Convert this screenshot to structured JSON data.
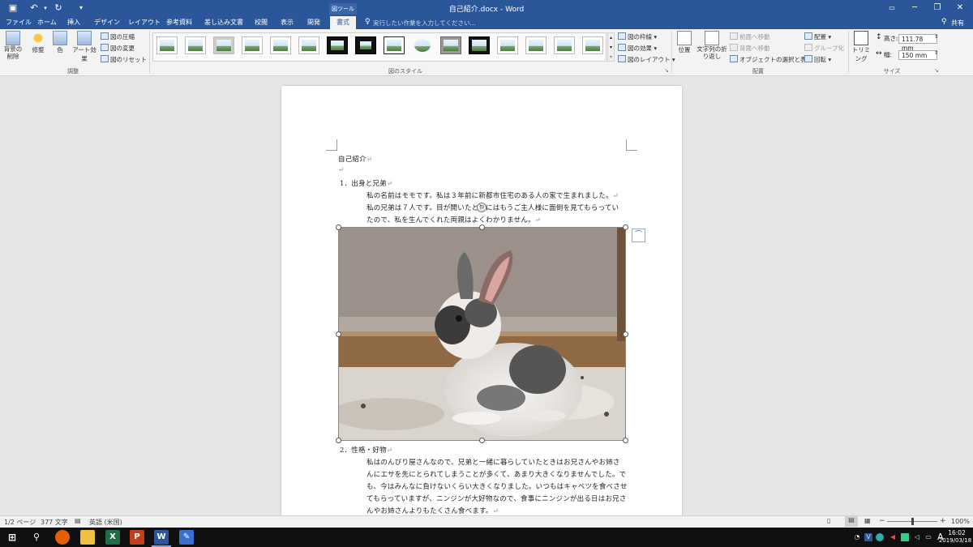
{
  "title_bar": {
    "title": "自己紹介.docx - Word",
    "context_label": "図ツール",
    "qat": {
      "save_icon": "save-icon",
      "undo_icon": "undo-icon",
      "redo_icon": "redo-icon",
      "customize_icon": "customize-qat-icon"
    },
    "window_controls": {
      "ribbon_display": "ribbon-display-icon",
      "minimize": "─",
      "restore": "❐",
      "close": "✕"
    }
  },
  "tabs": {
    "items": [
      "ファイル",
      "ホーム",
      "挿入",
      "デザイン",
      "レイアウト",
      "参考資料",
      "差し込み文書",
      "校閲",
      "表示",
      "開発",
      "書式"
    ],
    "active": "書式",
    "tell_me": "実行したい作業を入力してください...",
    "share": "共有"
  },
  "ribbon": {
    "adjust": {
      "remove_background": "背景の削除",
      "corrections": "修整",
      "color": "色",
      "artistic_effects": "アート効果",
      "compress": "図の圧縮",
      "change_picture": "図の変更",
      "reset_picture": "図のリセット",
      "group_label": "調整"
    },
    "styles": {
      "thumbs": [
        "simple-frame-white",
        "soft-edge",
        "simple-frame-gray",
        "drop-shadow",
        "reflected",
        "soft-rounded",
        "thick-black-frame",
        "heavy-black-frame",
        "simple-frame-black",
        "oval",
        "metal-frame",
        "black-rect",
        "beveled",
        "rotated-white",
        "perspective",
        "relaxed-perspective"
      ],
      "border": "図の枠線",
      "effects": "図の効果",
      "layout": "図のレイアウト",
      "group_label": "図のスタイル"
    },
    "arrange": {
      "position": "位置",
      "wrap_text": "文字列の折り返し",
      "bring_forward": "前面へ移動",
      "send_backward": "背面へ移動",
      "selection_pane": "オブジェクトの選択と表示",
      "align": "配置",
      "group": "グループ化",
      "rotate": "回転",
      "group_label": "配置"
    },
    "size": {
      "crop": "トリミング",
      "height_label": "高さ:",
      "height_value": "111.78 mm",
      "width_label": "幅:",
      "width_value": "150 mm",
      "group_label": "サイズ"
    }
  },
  "document": {
    "title": "自己紹介",
    "paragraph_mark": "↵",
    "section1_heading": "1．出身と兄弟",
    "section1_lines": [
      "私の名前はモモです。私は３年前に新都市住宅のある人の家で生まれました。",
      "私の兄弟は７人です。目が開いたときにはもうご主人様に面倒を見てもらってい",
      "たので、私を生んでくれた両親はよくわかりません。"
    ],
    "picture_subject": "rabbit-photo",
    "section2_heading": "2．性格・好物",
    "section2_lines": [
      "私はのんびり屋さんなので、兄弟と一緒に暮らしていたときはお兄さんやお姉さ",
      "んにエサを先にとられてしまうことが多くて、あまり大きくなりませんでした。で",
      "も、今はみんなに負けないくらい大きくなりました。いつもはキャベツを食べさせ",
      "てもらっていますが、ニンジンが大好物なので、食事にニンジンが出る日はお兄さ",
      "んやお姉さんよりもたくさん食べます。"
    ]
  },
  "status_bar": {
    "page": "1/2 ページ",
    "words": "377 文字",
    "language": "英語 (米国)",
    "zoom": "100%",
    "zoom_level": 0.5
  },
  "taskbar": {
    "apps": [
      "start",
      "search",
      "firefox",
      "explorer",
      "excel",
      "powerpoint",
      "word",
      "paint"
    ],
    "ime": "A",
    "time": "16:02",
    "date": "2019/03/18"
  },
  "colors": {
    "word_blue": "#2b579a",
    "taskbar": "#101010"
  }
}
